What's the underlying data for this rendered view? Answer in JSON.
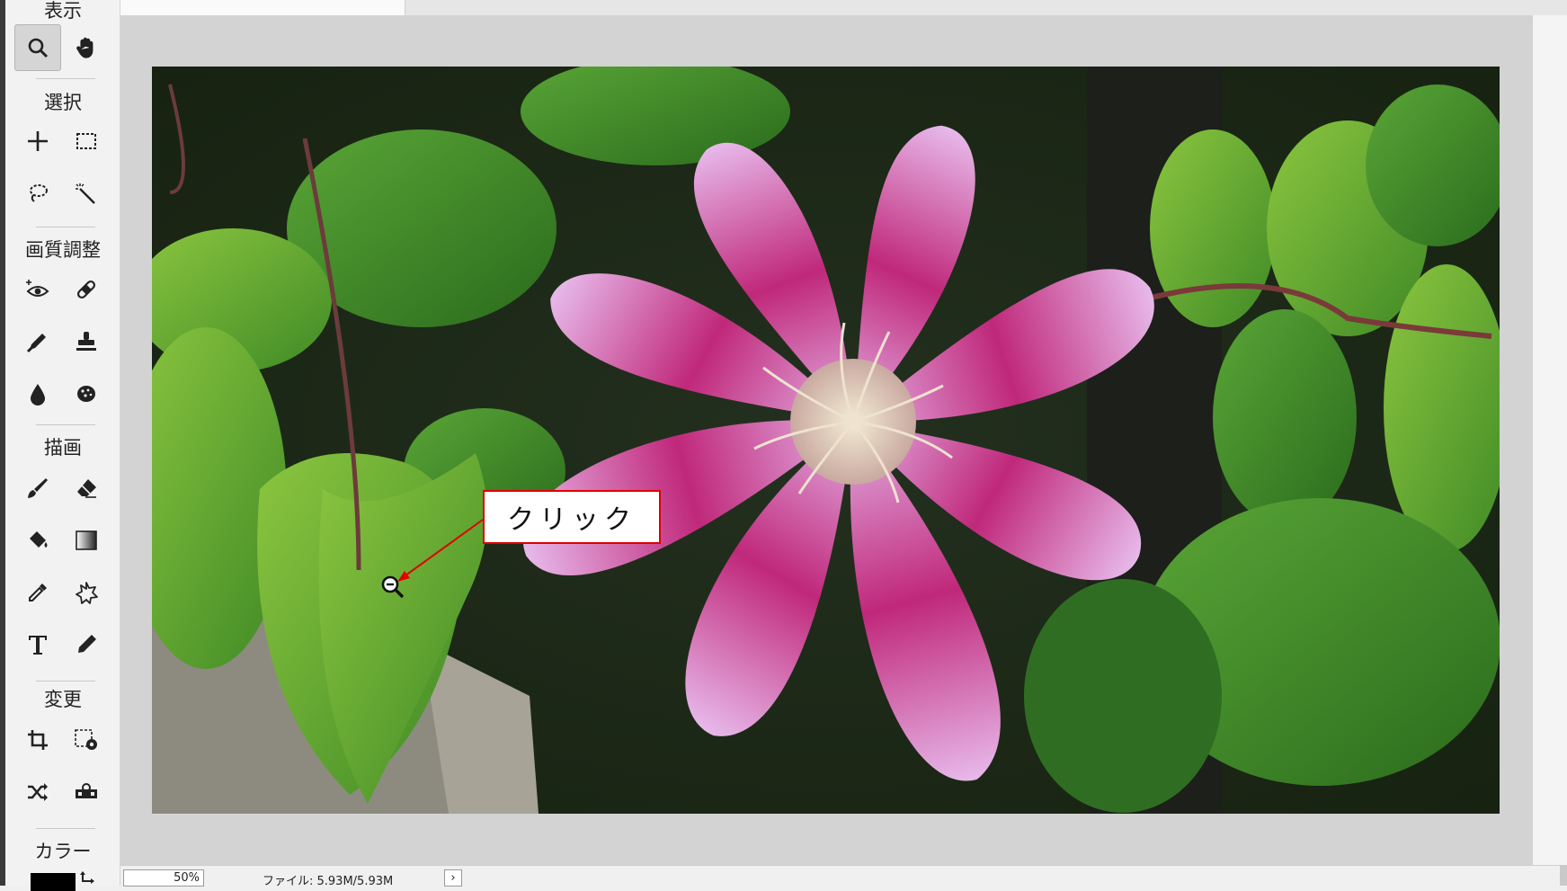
{
  "toolbar": {
    "sections": {
      "view": "表示",
      "select": "選択",
      "adjust": "画質調整",
      "draw": "描画",
      "transform": "変更",
      "color": "カラー"
    },
    "active_tool": "zoom-tool",
    "icons": [
      "zoom-icon",
      "hand-icon",
      "move-icon",
      "rect-select-icon",
      "lasso-icon",
      "magic-wand-icon",
      "red-eye-icon",
      "bandage-icon",
      "brush-fix-icon",
      "stamp-icon",
      "drop-icon",
      "sponge-icon",
      "brush-icon",
      "eraser-icon",
      "bucket-icon",
      "gradient-icon",
      "eyedropper-icon",
      "shape-icon",
      "text-icon",
      "pencil-icon",
      "crop-icon",
      "canvas-settings-icon",
      "shuffle-icon",
      "mask-icon"
    ],
    "foreground_color": "#000000"
  },
  "callout": {
    "text": "クリック",
    "border_color": "#e00000"
  },
  "status": {
    "zoom": "50%",
    "file_info": "ファイル: 5.93M/5.93M",
    "expand_arrow": "›"
  },
  "image": {
    "subject": "pink clematis flower with green leaves",
    "cursor": "zoom-out-cursor-icon"
  }
}
